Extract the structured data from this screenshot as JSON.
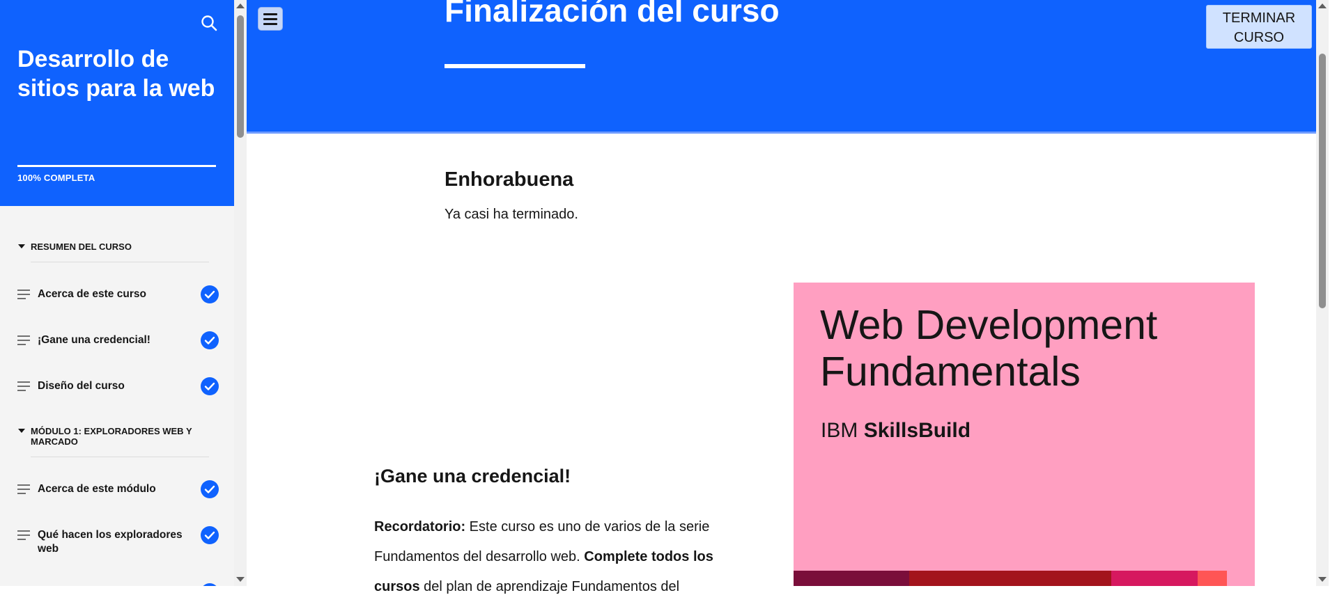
{
  "sidebar": {
    "course_title": "Desarrollo de sitios para la web",
    "progress_label": "100% COMPLETA",
    "progress_value": 1.0,
    "sections": [
      {
        "label": "RESUMEN DEL CURSO",
        "items": [
          {
            "label": "Acerca de este curso",
            "completed": true
          },
          {
            "label": "¡Gane una credencial!",
            "completed": true
          },
          {
            "label": "Diseño del curso",
            "completed": true
          }
        ]
      },
      {
        "label": "MÓDULO 1: EXPLORADORES WEB Y MARCADO",
        "items": [
          {
            "label": "Acerca de este módulo",
            "completed": true
          },
          {
            "label": "Qué hacen los exploradores web",
            "completed": true
          }
        ]
      }
    ]
  },
  "header": {
    "title": "Finalización del curso",
    "finish_button": "TERMINAR CURSO"
  },
  "content": {
    "congrats_heading": "Enhorabuena",
    "almost_done": "Ya casi ha terminado.",
    "credential_heading": "¡Gane una credencial!",
    "reminder_label": "Recordatorio:",
    "reminder_text_1": " Este curso es uno de varios de la serie Fundamentos del desarrollo web. ",
    "reminder_bold": "Complete todos los cursos",
    "reminder_text_2": " del plan de aprendizaje Fundamentos del"
  },
  "badge": {
    "title": "Web Development Fundamentals",
    "brand_prefix": "IBM",
    "brand_name": "SkillsBuild",
    "background_color": "#ff9fc1",
    "strip_colors": [
      "#7a0e3a",
      "#a3141c",
      "#a3141c",
      "#d6185f",
      "#ff5555",
      "#ff9fc1"
    ]
  },
  "colors": {
    "primary": "#0f62fe",
    "check": "#0f62fe",
    "button_bg": "#d0e2ff"
  }
}
